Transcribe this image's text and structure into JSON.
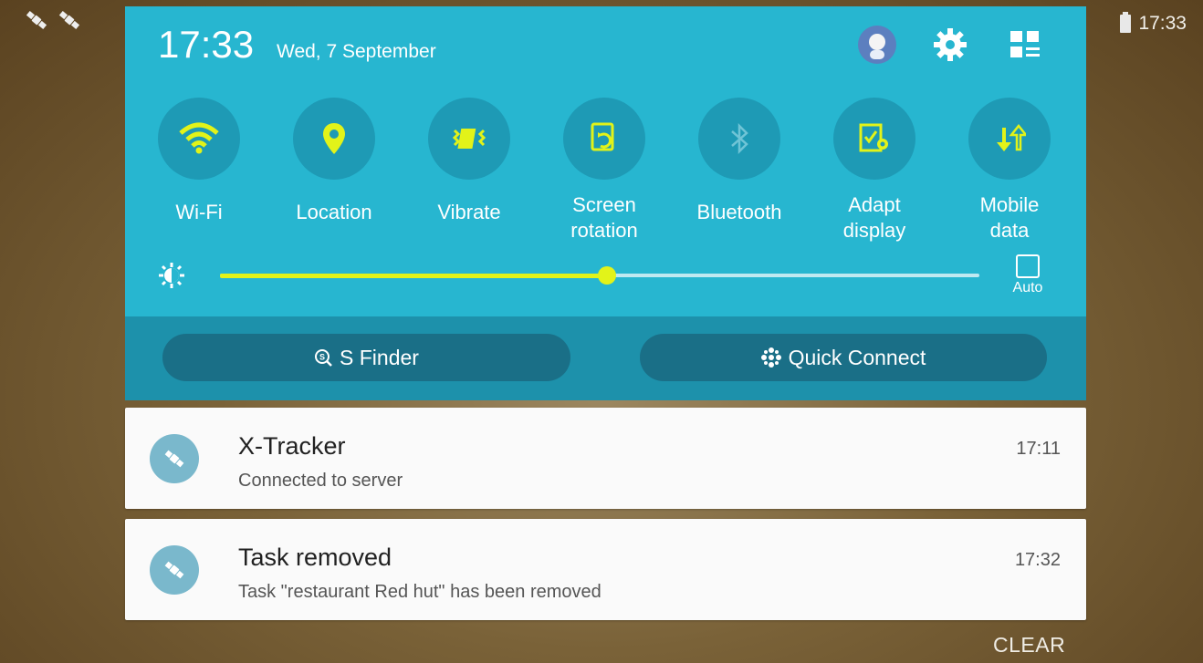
{
  "status_bar": {
    "time": "17:33",
    "left_icons": [
      "satellite-icon",
      "satellite-icon"
    ],
    "battery_icon": "battery-icon"
  },
  "panel": {
    "clock": "17:33",
    "date": "Wed, 7 September",
    "header_icons": [
      "avatar-icon",
      "gear-icon",
      "grid-edit-icon"
    ],
    "colors": {
      "panel_top": "#27b6d0",
      "panel_bottom": "#1d91ab",
      "accent": "#e2f319"
    }
  },
  "toggles": [
    {
      "label": "Wi-Fi",
      "icon": "wifi-icon",
      "active": true
    },
    {
      "label": "Location",
      "icon": "location-pin-icon",
      "active": true
    },
    {
      "label": "Vibrate",
      "icon": "vibrate-icon",
      "active": true
    },
    {
      "label_line1": "Screen",
      "label_line2": "rotation",
      "icon": "screen-rotation-icon",
      "active": true
    },
    {
      "label": "Bluetooth",
      "icon": "bluetooth-icon",
      "active": false
    },
    {
      "label_line1": "Adapt",
      "label_line2": "display",
      "icon": "adapt-display-icon",
      "active": true
    },
    {
      "label_line1": "Mobile",
      "label_line2": "data",
      "icon": "mobile-data-icon",
      "active": true
    }
  ],
  "brightness": {
    "level": 0.51,
    "auto_label": "Auto",
    "auto_checked": false
  },
  "actions": {
    "s_finder": "S Finder",
    "quick_connect": "Quick Connect"
  },
  "notifications": [
    {
      "title": "X-Tracker",
      "body": "Connected to server",
      "time": "17:11",
      "icon": "satellite-icon"
    },
    {
      "title": "Task removed",
      "body": "Task \"restaurant Red hut\" has been removed",
      "time": "17:32",
      "icon": "satellite-icon"
    }
  ],
  "clear_label": "CLEAR"
}
